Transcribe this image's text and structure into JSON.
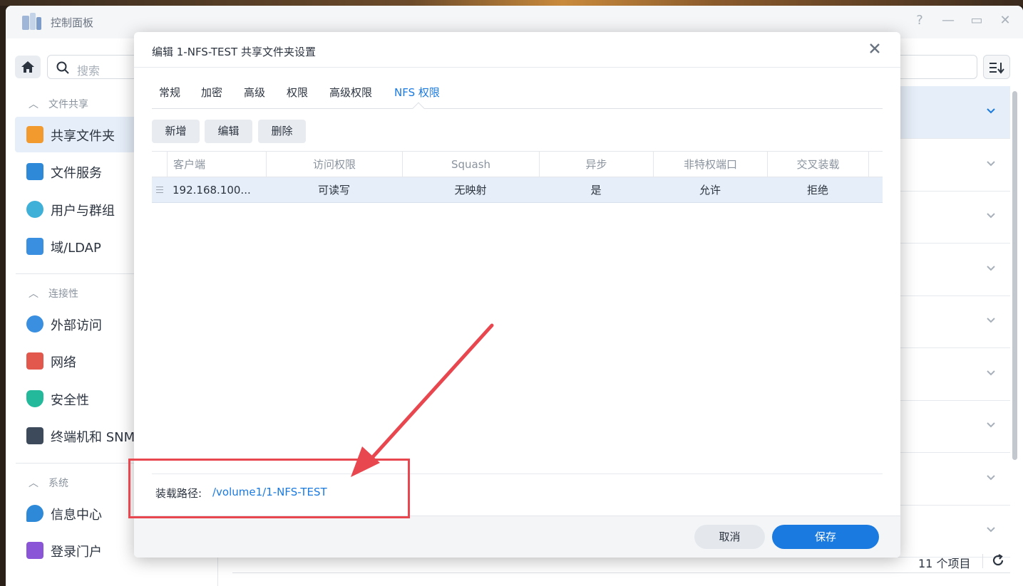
{
  "window": {
    "title": "控制面板",
    "help": "?",
    "minimize": "—",
    "maximize": "▭",
    "close": "✕"
  },
  "search": {
    "placeholder": "搜索"
  },
  "sidebar": {
    "sections": [
      {
        "title": "文件共享",
        "items": [
          {
            "label": "共享文件夹",
            "active": true
          },
          {
            "label": "文件服务"
          },
          {
            "label": "用户与群组"
          },
          {
            "label": "域/LDAP"
          }
        ]
      },
      {
        "title": "连接性",
        "items": [
          {
            "label": "外部访问"
          },
          {
            "label": "网络"
          },
          {
            "label": "安全性"
          },
          {
            "label": "终端机和 SNMP"
          }
        ]
      },
      {
        "title": "系统",
        "items": [
          {
            "label": "信息中心"
          },
          {
            "label": "登录门户"
          }
        ]
      }
    ]
  },
  "main": {
    "item_count": "11 个项目"
  },
  "dialog": {
    "title": "编辑 1-NFS-TEST 共享文件夹设置",
    "tabs": [
      "常规",
      "加密",
      "高级",
      "权限",
      "高级权限",
      "NFS 权限"
    ],
    "active_tab": "NFS 权限",
    "toolbar": {
      "add": "新增",
      "edit": "编辑",
      "delete": "删除"
    },
    "grid": {
      "columns": [
        "客户端",
        "访问权限",
        "Squash",
        "异步",
        "非特权端口",
        "交叉装载"
      ],
      "rows": [
        [
          "192.168.100...",
          "可读写",
          "无映射",
          "是",
          "允许",
          "拒绝"
        ]
      ]
    },
    "mount_path_label": "装载路径:",
    "mount_path_value": "/volume1/1-NFS-TEST",
    "cancel": "取消",
    "save": "保存"
  },
  "colors": {
    "accent": "#1a7ae0",
    "annotation": "#e8474f",
    "selected_row": "#e6eef9"
  }
}
